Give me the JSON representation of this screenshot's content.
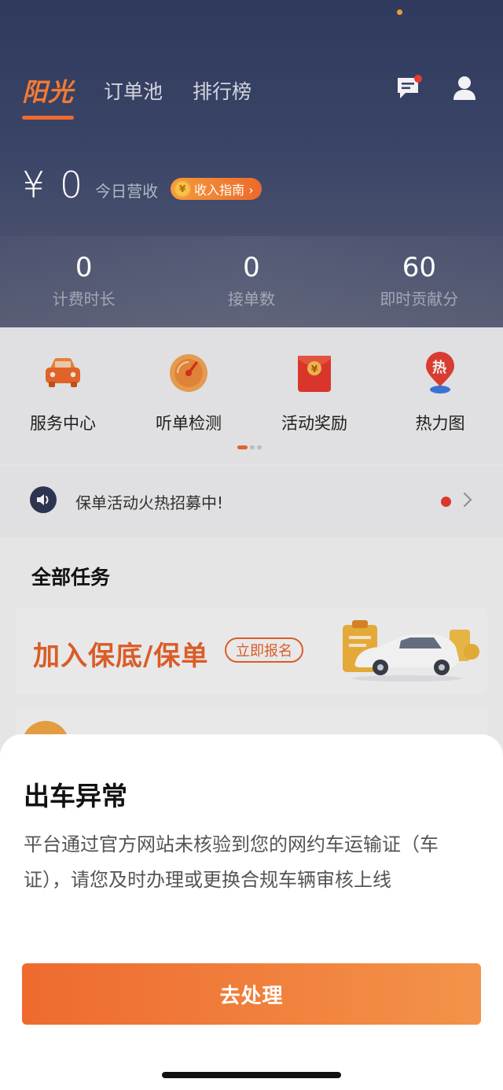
{
  "header": {
    "tabs": {
      "brand": "阳光",
      "order_pool": "订单池",
      "ranking": "排行榜"
    },
    "icons": {
      "message": "message-icon",
      "user": "user-icon"
    },
    "earnings": {
      "amount": "¥ 0",
      "label": "今日营收",
      "guide_button": "收入指南 ›",
      "coin_symbol": "¥"
    },
    "stats": [
      {
        "value": "0",
        "label": "计费时长"
      },
      {
        "value": "0",
        "label": "接单数"
      },
      {
        "value": "60",
        "label": "即时贡献分"
      }
    ]
  },
  "quick_entries": [
    {
      "label": "服务中心",
      "icon": "car-icon"
    },
    {
      "label": "听单检测",
      "icon": "gauge-icon"
    },
    {
      "label": "活动奖励",
      "icon": "red-envelope-icon"
    },
    {
      "label": "热力图",
      "icon": "heatmap-pin-icon",
      "icon_text": "热"
    }
  ],
  "notice": {
    "text": "保单活动火热招募中!"
  },
  "tasks": {
    "title": "全部任务",
    "card": {
      "text": "加入保底/保单",
      "button": "立即报名"
    }
  },
  "sheet": {
    "title": "出车异常",
    "body": "平台通过官方网站未核验到您的网约车运输证（车证），请您及时办理或更换合规车辆审核上线",
    "button": "去处理"
  },
  "colors": {
    "accent": "#ee6b2c",
    "header_bg": "#2f3a5e",
    "badge_red": "#e53d32"
  }
}
